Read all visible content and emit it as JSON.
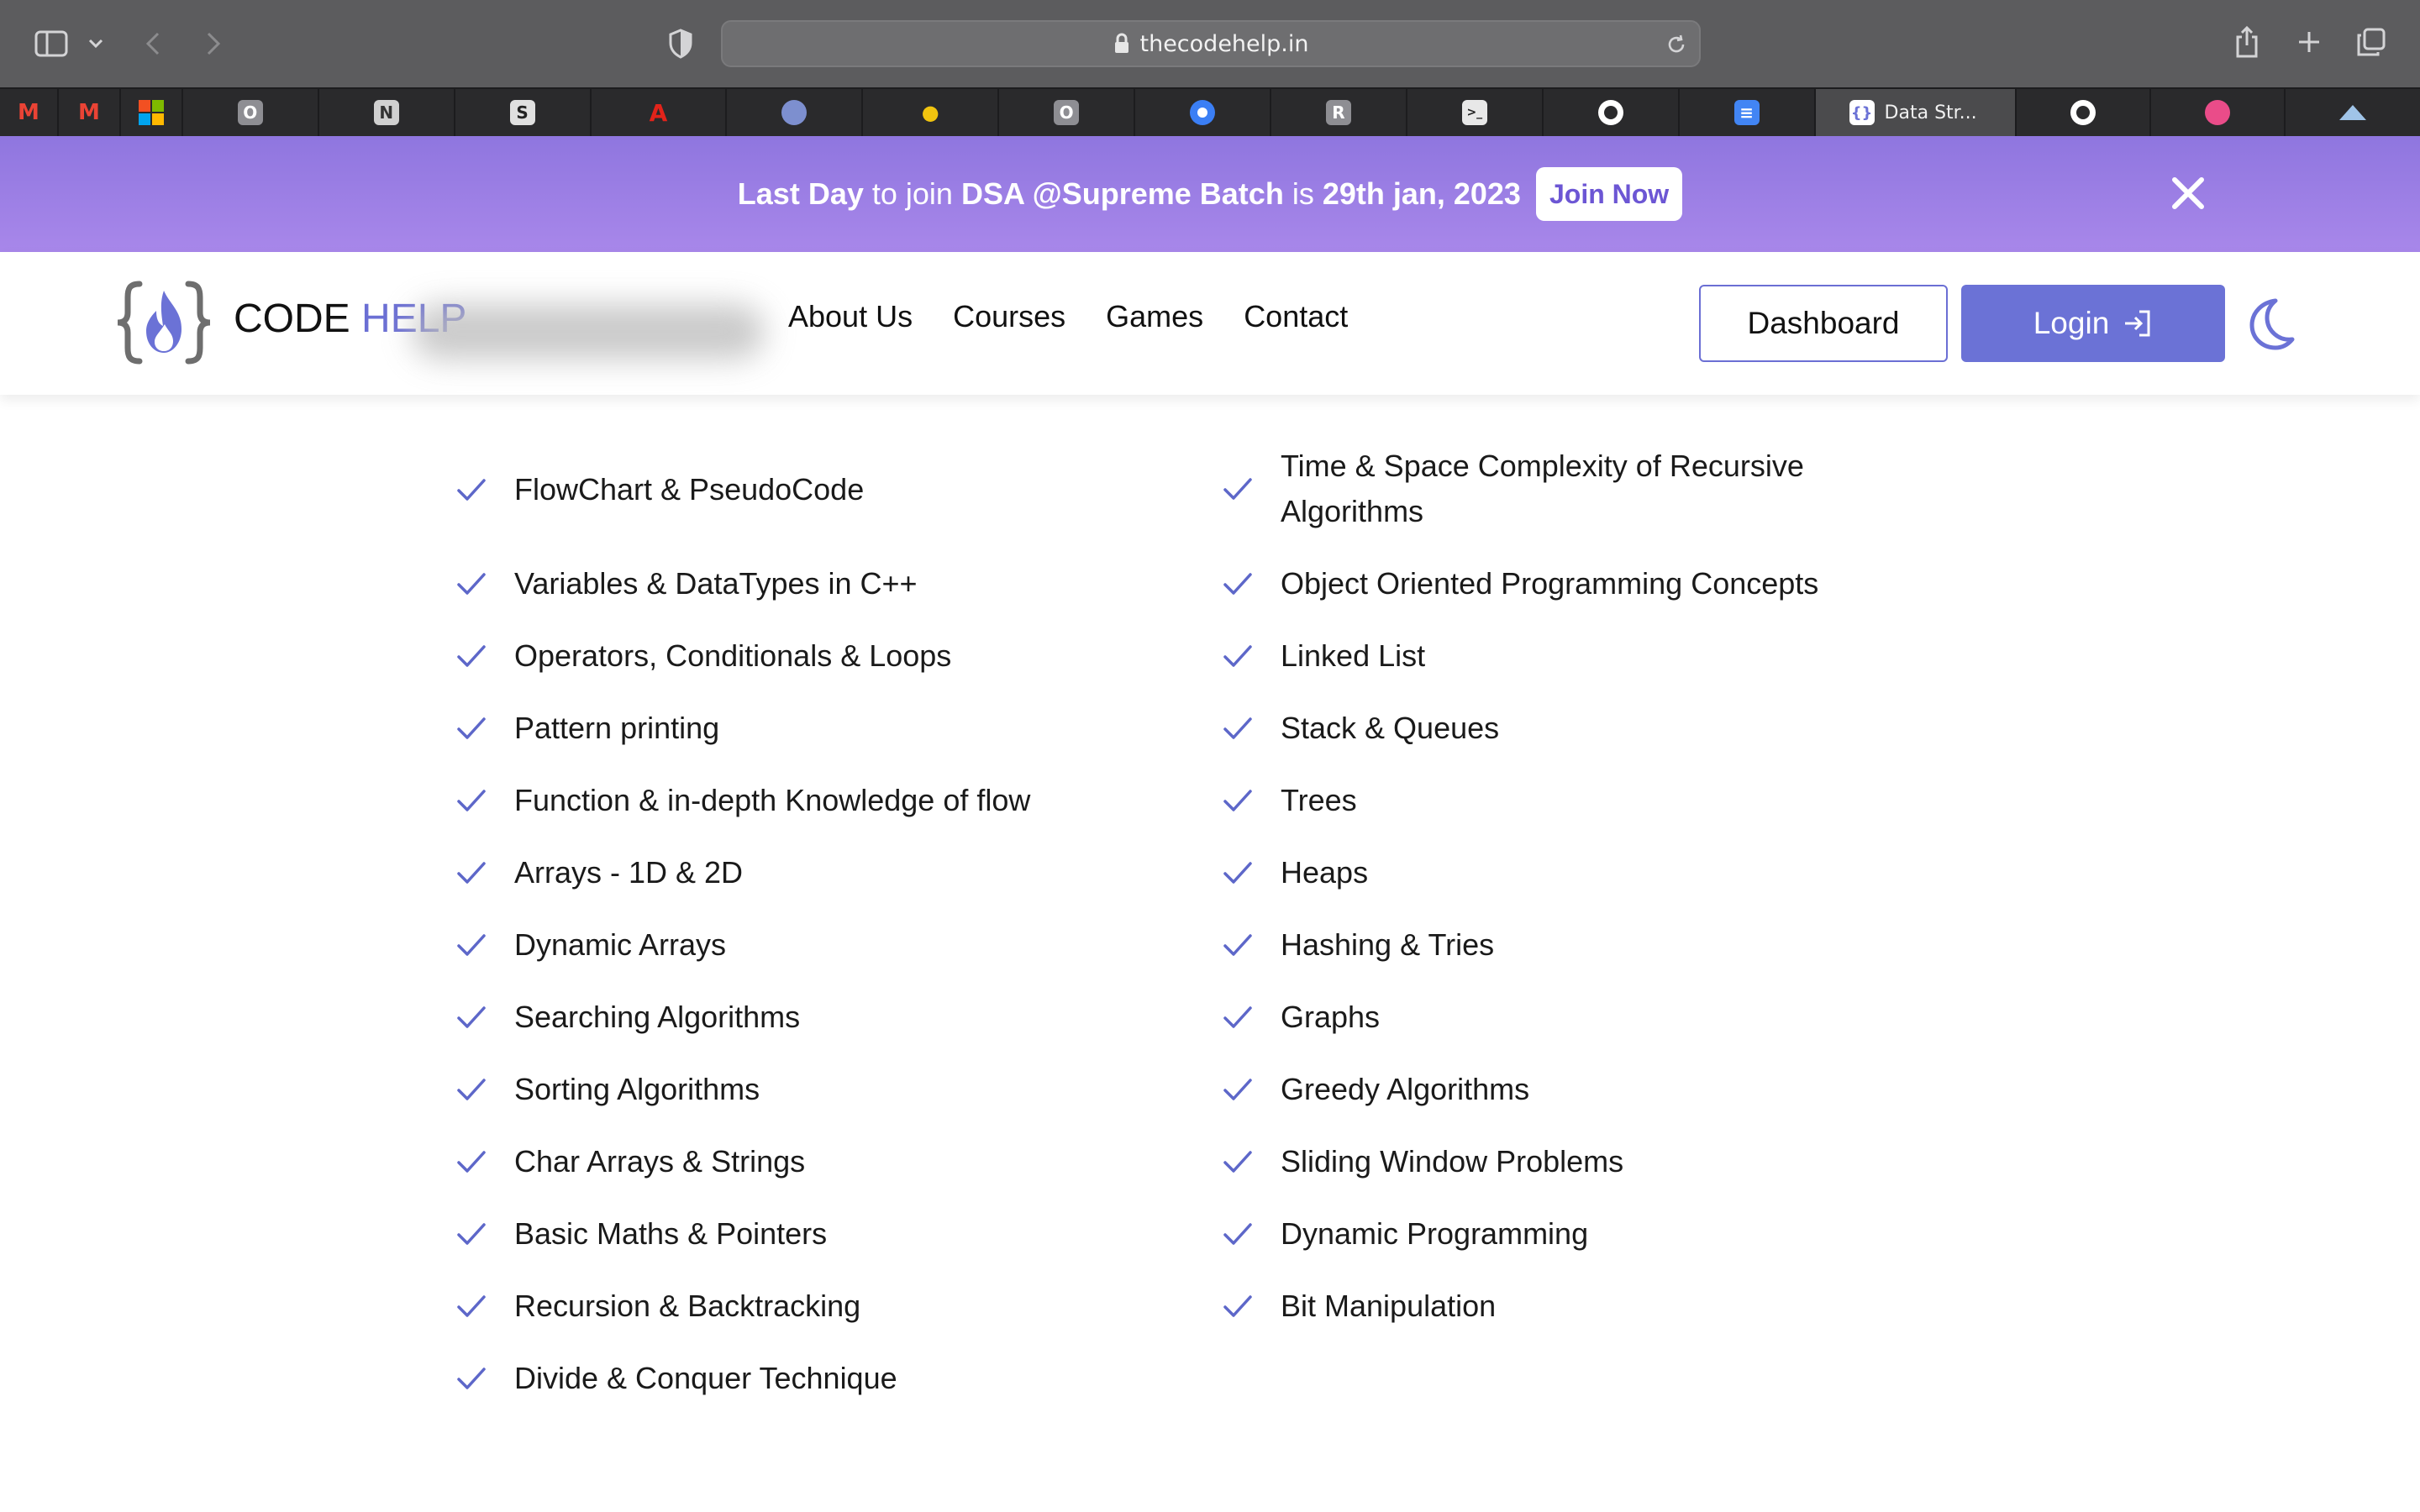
{
  "browser": {
    "url": "thecodehelp.in",
    "active_tab_title": "Data Str...",
    "tabs": [
      {
        "icon": "gmail-icon",
        "letter": "M",
        "color": "#ea4335"
      },
      {
        "icon": "gmail-icon",
        "letter": "M",
        "color": "#ea4335"
      },
      {
        "icon": "microsoft-icon",
        "letter": "",
        "color": "#f25022"
      },
      {
        "icon": "notion-like-icon",
        "letter": "O",
        "color": "#8e8e93"
      },
      {
        "icon": "grid-app-icon",
        "letter": "N",
        "color": "#8e8e93"
      },
      {
        "icon": "medium-like-icon",
        "letter": "S",
        "color": "#cfcfcf"
      },
      {
        "icon": "adobe-icon",
        "letter": "A",
        "color": "#e2231a"
      },
      {
        "icon": "globe-seal-icon",
        "letter": "",
        "color": "#7d8fcf"
      },
      {
        "icon": "lightbulb-icon",
        "letter": "",
        "color": "#f1c40f"
      },
      {
        "icon": "notion-like-icon",
        "letter": "O",
        "color": "#8e8e93"
      },
      {
        "icon": "target-icon",
        "letter": "",
        "color": "#3b7ff5"
      },
      {
        "icon": "r-app-icon",
        "letter": "R",
        "color": "#8e8e93"
      },
      {
        "icon": "terminal-icon",
        "letter": "",
        "color": "#cfcfcf"
      },
      {
        "icon": "github-icon",
        "letter": "",
        "color": "#ffffff"
      },
      {
        "icon": "docs-icon",
        "letter": "",
        "color": "#4285f4"
      },
      {
        "icon": "codehelp-favicon",
        "letter": "",
        "color": "#6b72d6"
      },
      {
        "icon": "github-icon",
        "letter": "",
        "color": "#ffffff"
      },
      {
        "icon": "dribbble-icon",
        "letter": "",
        "color": "#ea4c89"
      },
      {
        "icon": "mountain-icon",
        "letter": "",
        "color": "#a0c4e8"
      }
    ]
  },
  "banner": {
    "part1": "Last Day",
    "part2": " to join ",
    "part3": "DSA @Supreme Batch",
    "part4": " is ",
    "part5": "29th jan, 2023",
    "join_label": "Join Now"
  },
  "header": {
    "logo_word1": "CODE",
    "logo_word2": "HELP",
    "nav": [
      "About Us",
      "Courses",
      "Games",
      "Contact"
    ],
    "dashboard_label": "Dashboard",
    "login_label": "Login"
  },
  "curriculum": {
    "left": [
      "FlowChart & PseudoCode",
      "Variables & DataTypes in C++",
      "Operators, Conditionals & Loops",
      "Pattern printing",
      "Function & in-depth Knowledge of flow",
      "Arrays - 1D & 2D",
      "Dynamic Arrays",
      "Searching Algorithms",
      "Sorting Algorithms",
      "Char Arrays & Strings",
      "Basic Maths & Pointers",
      "Recursion & Backtracking",
      "Divide & Conquer Technique"
    ],
    "right": [
      "Time & Space Complexity of Recursive Algorithms",
      "Object Oriented Programming Concepts",
      "Linked List",
      "Stack & Queues",
      "Trees",
      "Heaps",
      "Hashing & Tries",
      "Graphs",
      "Greedy Algorithms",
      "Sliding Window Problems",
      "Dynamic Programming",
      "Bit Manipulation"
    ]
  },
  "colors": {
    "accent": "#6b72d6",
    "banner_start": "#8f76df",
    "banner_end": "#a887ea",
    "check": "#5d67c9"
  }
}
